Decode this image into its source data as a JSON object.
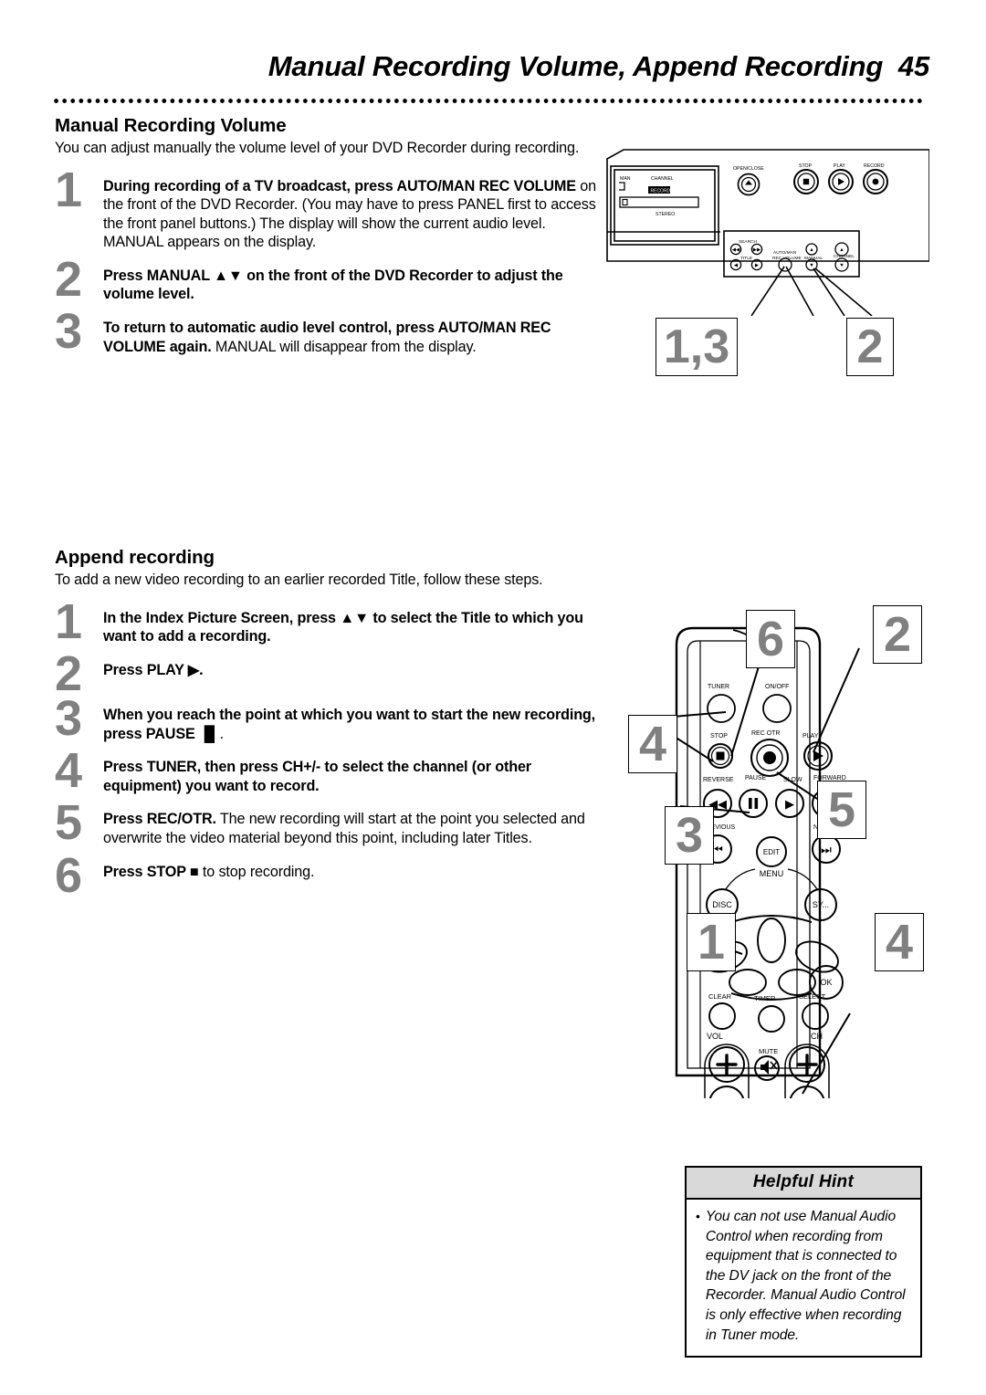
{
  "header": {
    "title": "Manual Recording Volume, Append Recording",
    "page_number": "45"
  },
  "section1": {
    "heading": "Manual Recording Volume",
    "intro": "You can adjust manually the volume level of your DVD Recorder during recording.",
    "steps": [
      {
        "num": "1",
        "bold": "During recording of a TV broadcast, press AUTO/MAN REC VOLUME",
        "rest": " on the front of the DVD Recorder. (You may have to press PANEL first to access the front panel buttons.) The display will show the current audio level. MANUAL appears on the display."
      },
      {
        "num": "2",
        "bold": "Press MANUAL ▲▼ on the front of the DVD Recorder to adjust the volume level.",
        "rest": ""
      },
      {
        "num": "3",
        "bold": "To return to automatic audio level control, press AUTO/MAN REC VOLUME again.",
        "rest": " MANUAL will disappear from the display."
      }
    ]
  },
  "section2": {
    "heading": "Append recording",
    "intro": "To add a new video recording to an earlier recorded Title, follow these steps.",
    "steps": [
      {
        "num": "1",
        "bold": "In the Index Picture Screen, press ▲▼ to select the Title to which you want to add a recording.",
        "rest": ""
      },
      {
        "num": "2",
        "bold": "Press PLAY ▶.",
        "rest": ""
      },
      {
        "num": "3",
        "bold": "When you reach the point at which you want to start the new recording, press PAUSE ▐▌",
        "rest": "."
      },
      {
        "num": "4",
        "bold": "Press TUNER, then press CH+/- to select the channel (or other equipment) you want to record.",
        "rest": ""
      },
      {
        "num": "5",
        "bold": "Press REC/OTR.",
        "rest": " The new recording will start at the point you selected and overwrite the video material beyond this point, including later Titles."
      },
      {
        "num": "6",
        "bold": "Press STOP ■",
        "rest": " to stop recording."
      }
    ]
  },
  "front_panel": {
    "display_labels": [
      "MAN",
      "CHANNEL",
      "RECORD",
      "STEREO"
    ],
    "buttons": [
      {
        "label": "OPEN/CLOSE",
        "icon": "eject-icon"
      },
      {
        "label": "STOP",
        "icon": "stop-icon"
      },
      {
        "label": "PLAY",
        "icon": "play-icon"
      },
      {
        "label": "RECORD",
        "icon": "record-icon"
      }
    ],
    "panel_labels": [
      "SEARCH",
      "TITLE",
      "AUTO/MAN REC VOLUME",
      "MANUAL",
      "CHANNEL"
    ],
    "callouts": [
      {
        "text": "1,3"
      },
      {
        "text": "2"
      }
    ]
  },
  "remote": {
    "buttons": [
      {
        "label": "TUNER",
        "icon": "tuner-icon"
      },
      {
        "label": "ON/OFF",
        "icon": "power-icon"
      },
      {
        "label": "STOP",
        "icon": "stop-icon"
      },
      {
        "label": "REC/OTR",
        "icon": "record-icon"
      },
      {
        "label": "PLAY",
        "icon": "play-icon"
      },
      {
        "label": "REVERSE",
        "icon": "rewind-icon"
      },
      {
        "label": "PAUSE",
        "icon": "pause-icon"
      },
      {
        "label": "SLOW",
        "icon": "slow-icon"
      },
      {
        "label": "FORWARD",
        "icon": "fast-forward-icon"
      },
      {
        "label": "PREVIOUS",
        "icon": "previous-icon"
      },
      {
        "label": "EDIT",
        "icon": "edit-icon"
      },
      {
        "label": "NEXT",
        "icon": "next-icon"
      },
      {
        "label": "MENU",
        "icon": "menu-icon"
      },
      {
        "label": "DISC",
        "icon": "disc-icon"
      },
      {
        "label": "SYSTEM",
        "icon": "system-icon"
      },
      {
        "label": "OK",
        "icon": "ok-icon"
      },
      {
        "label": "CLEAR",
        "icon": "clear-icon"
      },
      {
        "label": "TIMER",
        "icon": "timer-icon"
      },
      {
        "label": "SELECT",
        "icon": "select-icon"
      },
      {
        "label": "VOL",
        "icon": "volume-icon"
      },
      {
        "label": "MUTE",
        "icon": "mute-icon"
      },
      {
        "label": "CH",
        "icon": "channel-icon"
      }
    ],
    "callouts": [
      {
        "text": "6"
      },
      {
        "text": "2"
      },
      {
        "text": "4"
      },
      {
        "text": "5"
      },
      {
        "text": "3"
      },
      {
        "text": "1"
      },
      {
        "text": "4"
      }
    ]
  },
  "hint": {
    "title": "Helpful Hint",
    "bullet": "•",
    "text": "You can not use Manual Audio Control when recording from equipment that is connected to the DV jack on the front of the Recorder. Manual Audio Control is only effective when recording in Tuner mode."
  }
}
